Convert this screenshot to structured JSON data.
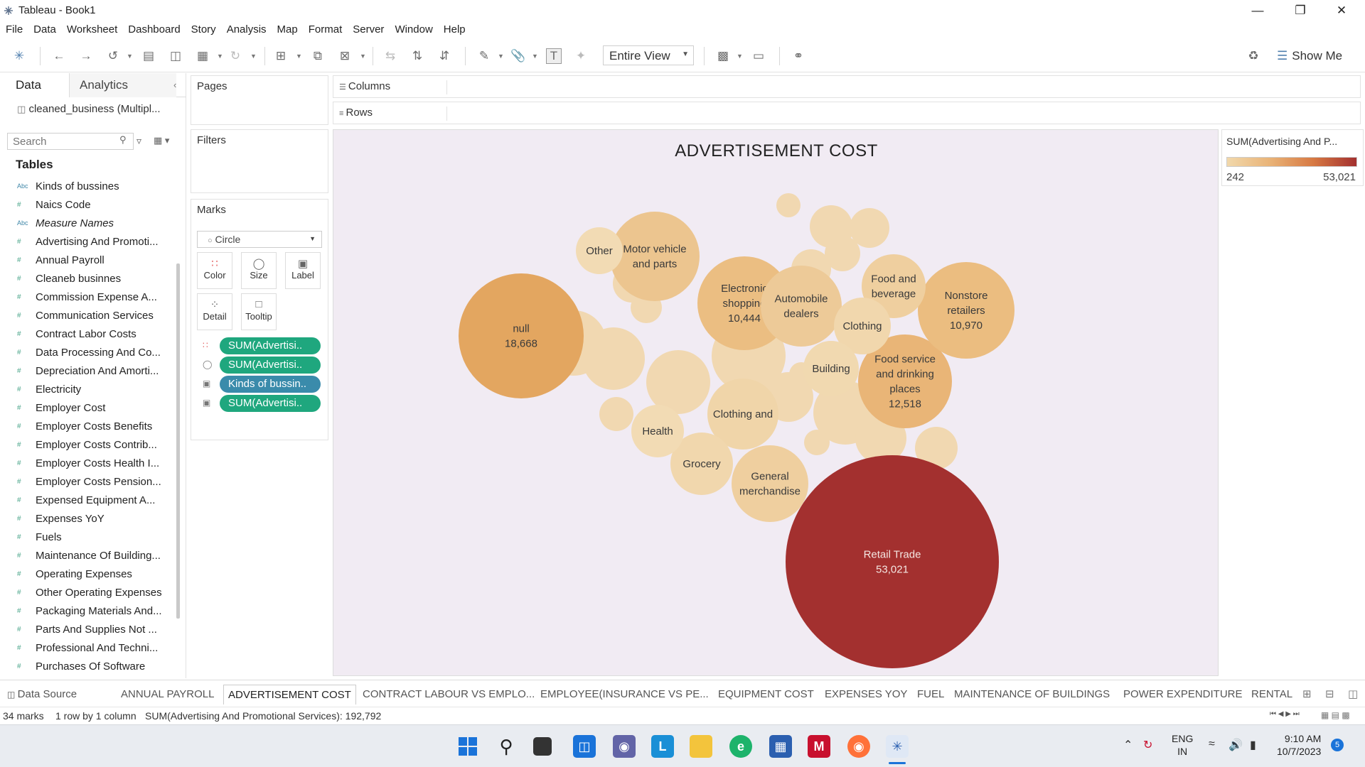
{
  "window": {
    "title": "Tableau - Book1"
  },
  "menu": [
    "File",
    "Data",
    "Worksheet",
    "Dashboard",
    "Story",
    "Analysis",
    "Map",
    "Format",
    "Server",
    "Window",
    "Help"
  ],
  "toolbar": {
    "fit_value": "Entire View",
    "show_me_label": "Show Me"
  },
  "data_pane": {
    "tabs": [
      "Data",
      "Analytics"
    ],
    "datasource": "cleaned_business (Multipl...",
    "search_placeholder": "Search",
    "tables_heading": "Tables",
    "fields": [
      {
        "type": "Abc",
        "name": "Kinds of bussines"
      },
      {
        "type": "#",
        "name": "Naics Code"
      },
      {
        "type": "Abc",
        "name": "Measure Names",
        "italic": true
      },
      {
        "type": "#",
        "name": "Advertising And Promoti..."
      },
      {
        "type": "#",
        "name": "Annual Payroll"
      },
      {
        "type": "#",
        "name": "Cleaneb businnes"
      },
      {
        "type": "#",
        "name": "Commission Expense A..."
      },
      {
        "type": "#",
        "name": "Communication Services"
      },
      {
        "type": "#",
        "name": "Contract Labor Costs"
      },
      {
        "type": "#",
        "name": "Data Processing And Co..."
      },
      {
        "type": "#",
        "name": "Depreciation And Amorti..."
      },
      {
        "type": "#",
        "name": "Electricity"
      },
      {
        "type": "#",
        "name": "Employer Cost"
      },
      {
        "type": "#",
        "name": "Employer Costs Benefits"
      },
      {
        "type": "#",
        "name": "Employer Costs Contrib..."
      },
      {
        "type": "#",
        "name": "Employer Costs Health I..."
      },
      {
        "type": "#",
        "name": "Employer Costs Pension..."
      },
      {
        "type": "#",
        "name": "Expensed Equipment A..."
      },
      {
        "type": "#",
        "name": "Expenses YoY"
      },
      {
        "type": "#",
        "name": "Fuels"
      },
      {
        "type": "#",
        "name": "Maintenance Of Building..."
      },
      {
        "type": "#",
        "name": "Operating Expenses"
      },
      {
        "type": "#",
        "name": "Other Operating Expenses"
      },
      {
        "type": "#",
        "name": "Packaging Materials And..."
      },
      {
        "type": "#",
        "name": "Parts And Supplies Not ..."
      },
      {
        "type": "#",
        "name": "Professional And Techni..."
      },
      {
        "type": "#",
        "name": "Purchases Of Software"
      }
    ]
  },
  "cards": {
    "pages": "Pages",
    "filters": "Filters",
    "marks": "Marks",
    "mark_type": "Circle",
    "mark_buttons": [
      "Color",
      "Size",
      "Label",
      "Detail",
      "Tooltip"
    ],
    "pills": [
      {
        "icon": "color-dots-icon",
        "text": "SUM(Advertisi..",
        "color": "green"
      },
      {
        "icon": "size-icon",
        "text": "SUM(Advertisi..",
        "color": "green"
      },
      {
        "icon": "label-icon",
        "text": "Kinds of bussin..",
        "color": "blue"
      },
      {
        "icon": "label-icon",
        "text": "SUM(Advertisi..",
        "color": "green"
      }
    ]
  },
  "shelves": {
    "columns": "Columns",
    "rows": "Rows"
  },
  "legend": {
    "title": "SUM(Advertising And P...",
    "min": "242",
    "max": "53,021"
  },
  "chart_data": {
    "type": "packed-bubble",
    "title": "ADVERTISEMENT COST",
    "measure": "SUM(Advertising And Promotional Services)",
    "color_range": [
      242,
      53021
    ],
    "bubbles": [
      {
        "label": "Retail Trade",
        "value": 53021,
        "value_label": "53,021",
        "color": "#a3302f"
      },
      {
        "label": "null",
        "value": 18668,
        "value_label": "18,668",
        "color": "#e3a660"
      },
      {
        "label": "Food service and drinking places",
        "value": 12518,
        "value_label": "12,518",
        "color": "#e9b577"
      },
      {
        "label": "Nonstore retailers",
        "value": 10970,
        "value_label": "10,970",
        "color": "#ebbd80"
      },
      {
        "label": "Electronic shopping",
        "value": 10444,
        "value_label": "10,444",
        "color": "#ebbe82"
      },
      {
        "label": "Motor vehicle and parts",
        "value": null,
        "color": "#ecc58f"
      },
      {
        "label": "Automobile dealers",
        "value": null,
        "color": "#edca98"
      },
      {
        "label": "Food and beverage",
        "value": null,
        "color": "#efcf9f"
      },
      {
        "label": "General merchandise",
        "value": null,
        "color": "#efcf9f"
      },
      {
        "label": "Clothing and",
        "value": null,
        "color": "#f0d5a9"
      },
      {
        "label": "Clothing",
        "value": null,
        "color": "#f1d7ad"
      },
      {
        "label": "Building",
        "value": null,
        "color": "#f1d9b0"
      },
      {
        "label": "Grocery",
        "value": null,
        "color": "#f1d7ad"
      },
      {
        "label": "Health",
        "value": null,
        "color": "#f2dbb4"
      },
      {
        "label": "Other",
        "value": null,
        "color": "#f2dbb4"
      }
    ],
    "unlabeled_bubble_count": 19
  },
  "sheet_tabs": [
    "Data Source",
    "ANNUAL PAYROLL",
    "ADVERTISEMENT COST",
    "CONTRACT LABOUR VS EMPLO...",
    "EMPLOYEE(INSURANCE VS PE...",
    "EQUIPMENT COST",
    "EXPENSES YOY",
    "FUEL",
    "MAINTENANCE OF BUILDINGS",
    "POWER EXPENDITURE",
    "RENTAL"
  ],
  "active_sheet": "ADVERTISEMENT COST",
  "status": {
    "marks": "34 marks",
    "dims": "1 row by 1 column",
    "sum": "SUM(Advertising And Promotional Services): 192,792"
  },
  "taskbar": {
    "lang": [
      "ENG",
      "IN"
    ],
    "time": "9:10 AM",
    "date": "10/7/2023",
    "notification_count": "5"
  }
}
